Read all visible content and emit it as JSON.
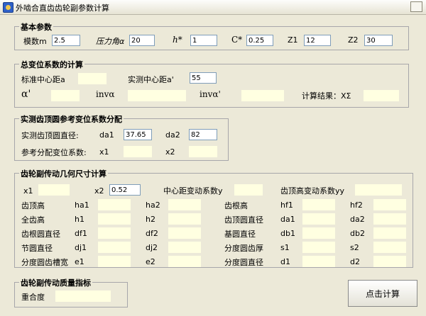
{
  "window": {
    "title": "外啮合直齿齿轮副参数计算"
  },
  "basic": {
    "title": "基本参数",
    "module_label": "模数m",
    "module_value": "2.5",
    "pressure_label": "压力角α",
    "pressure_value": "20",
    "ha_label": "h*",
    "ha_value": "1",
    "c_label": "C*",
    "c_value": "0.25",
    "z1_label": "Z1",
    "z1_value": "12",
    "z2_label": "Z2",
    "z2_value": "30"
  },
  "displacement": {
    "title": "总变位系数的计算",
    "std_center_label": "标准中心距a",
    "std_center_value": "",
    "real_center_label": "实测中心距a'",
    "real_center_value": "55",
    "alpha_prime_label": "α'",
    "alpha_prime_value": "",
    "inv_alpha_label": "invα",
    "inv_alpha_value": "",
    "inv_alpha_prime_label": "invα'",
    "inv_alpha_prime_value": "",
    "result_label": "计算结果：XΣ",
    "result_value": ""
  },
  "tip_dist": {
    "title": "实测齿顶圆参考变位系数分配",
    "tip_diam_label": "实测齿顶圆直径:",
    "da1_label": "da1",
    "da1_value": "37.65",
    "da2_label": "da2",
    "da2_value": "82",
    "ref_label": "参考分配变位系数:",
    "x1_label": "x1",
    "x1_value": "",
    "x2_label": "x2",
    "x2_value": ""
  },
  "geometry": {
    "title": "齿轮副传动几何尺寸计算",
    "x1_label": "x1",
    "x1_value": "",
    "x2_label": "x2",
    "x2_value": "0.52",
    "center_change_label": "中心距变动系数y",
    "center_change_value": "",
    "tip_change_label": "齿顶高变动系数yy",
    "tip_change_value": "",
    "rows": [
      {
        "left_label": "齿顶高",
        "a": "ha1",
        "b": "ha2",
        "right_label": "齿根高",
        "c": "hf1",
        "d": "hf2"
      },
      {
        "left_label": "全齿高",
        "a": "h1",
        "b": "h2",
        "right_label": "齿顶圆直径",
        "c": "da1",
        "d": "da2"
      },
      {
        "left_label": "齿根圆直径",
        "a": "df1",
        "b": "df2",
        "right_label": "基圆直径",
        "c": "db1",
        "d": "db2"
      },
      {
        "left_label": "节圆直径",
        "a": "dj1",
        "b": "dj2",
        "right_label": "分度圆齿厚",
        "c": "s1",
        "d": "s2"
      },
      {
        "left_label": "分度圆齿槽宽",
        "a": "e1",
        "b": "e2",
        "right_label": "分度圆直径",
        "c": "d1",
        "d": "d2"
      }
    ]
  },
  "quality": {
    "title": "齿轮副传动质量指标",
    "overlap_label": "重合度",
    "overlap_value": ""
  },
  "actions": {
    "calc_label": "点击计算"
  }
}
